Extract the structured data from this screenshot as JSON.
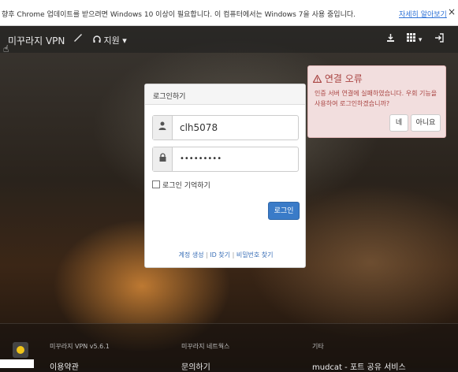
{
  "infobar": {
    "message": "향후 Chrome 업데이트를 받으려면 Windows 10 이상이 필요합니다. 이 컴퓨터에서는 Windows 7을 사용 중입니다.",
    "learn_more": "자세히 알아보기",
    "close_icon": "×"
  },
  "navbar": {
    "brand": "미꾸라지 VPN",
    "wrench_icon": "wrench-icon",
    "support_label": "지원",
    "download_icon": "download-icon",
    "apps_icon": "grid-icon",
    "login_icon": "sign-in-icon"
  },
  "login": {
    "title": "로그인하기",
    "username": "clh5078",
    "password_mask": "•••••••••",
    "remember_label": "로그인 기억하기",
    "submit_label": "로그인",
    "links": [
      "계정 생성",
      "ID 찾기",
      "비밀번호 찾기"
    ]
  },
  "alert": {
    "title": "연결 오류",
    "body": "인증 서버 연결에 실패하였습니다. 우회 기능을 사용하여 로그인하겠습니까?",
    "yes": "네",
    "no": "아니요"
  },
  "footer": {
    "col1_heading": "미꾸라지 VPN v5.6.1",
    "col1_link": "이용약관",
    "col2_heading": "미꾸라지 네트웍스",
    "col2_link": "문의하기",
    "col3_heading": "기타",
    "col3_link": "mudcat - 포트 공유 서비스"
  }
}
